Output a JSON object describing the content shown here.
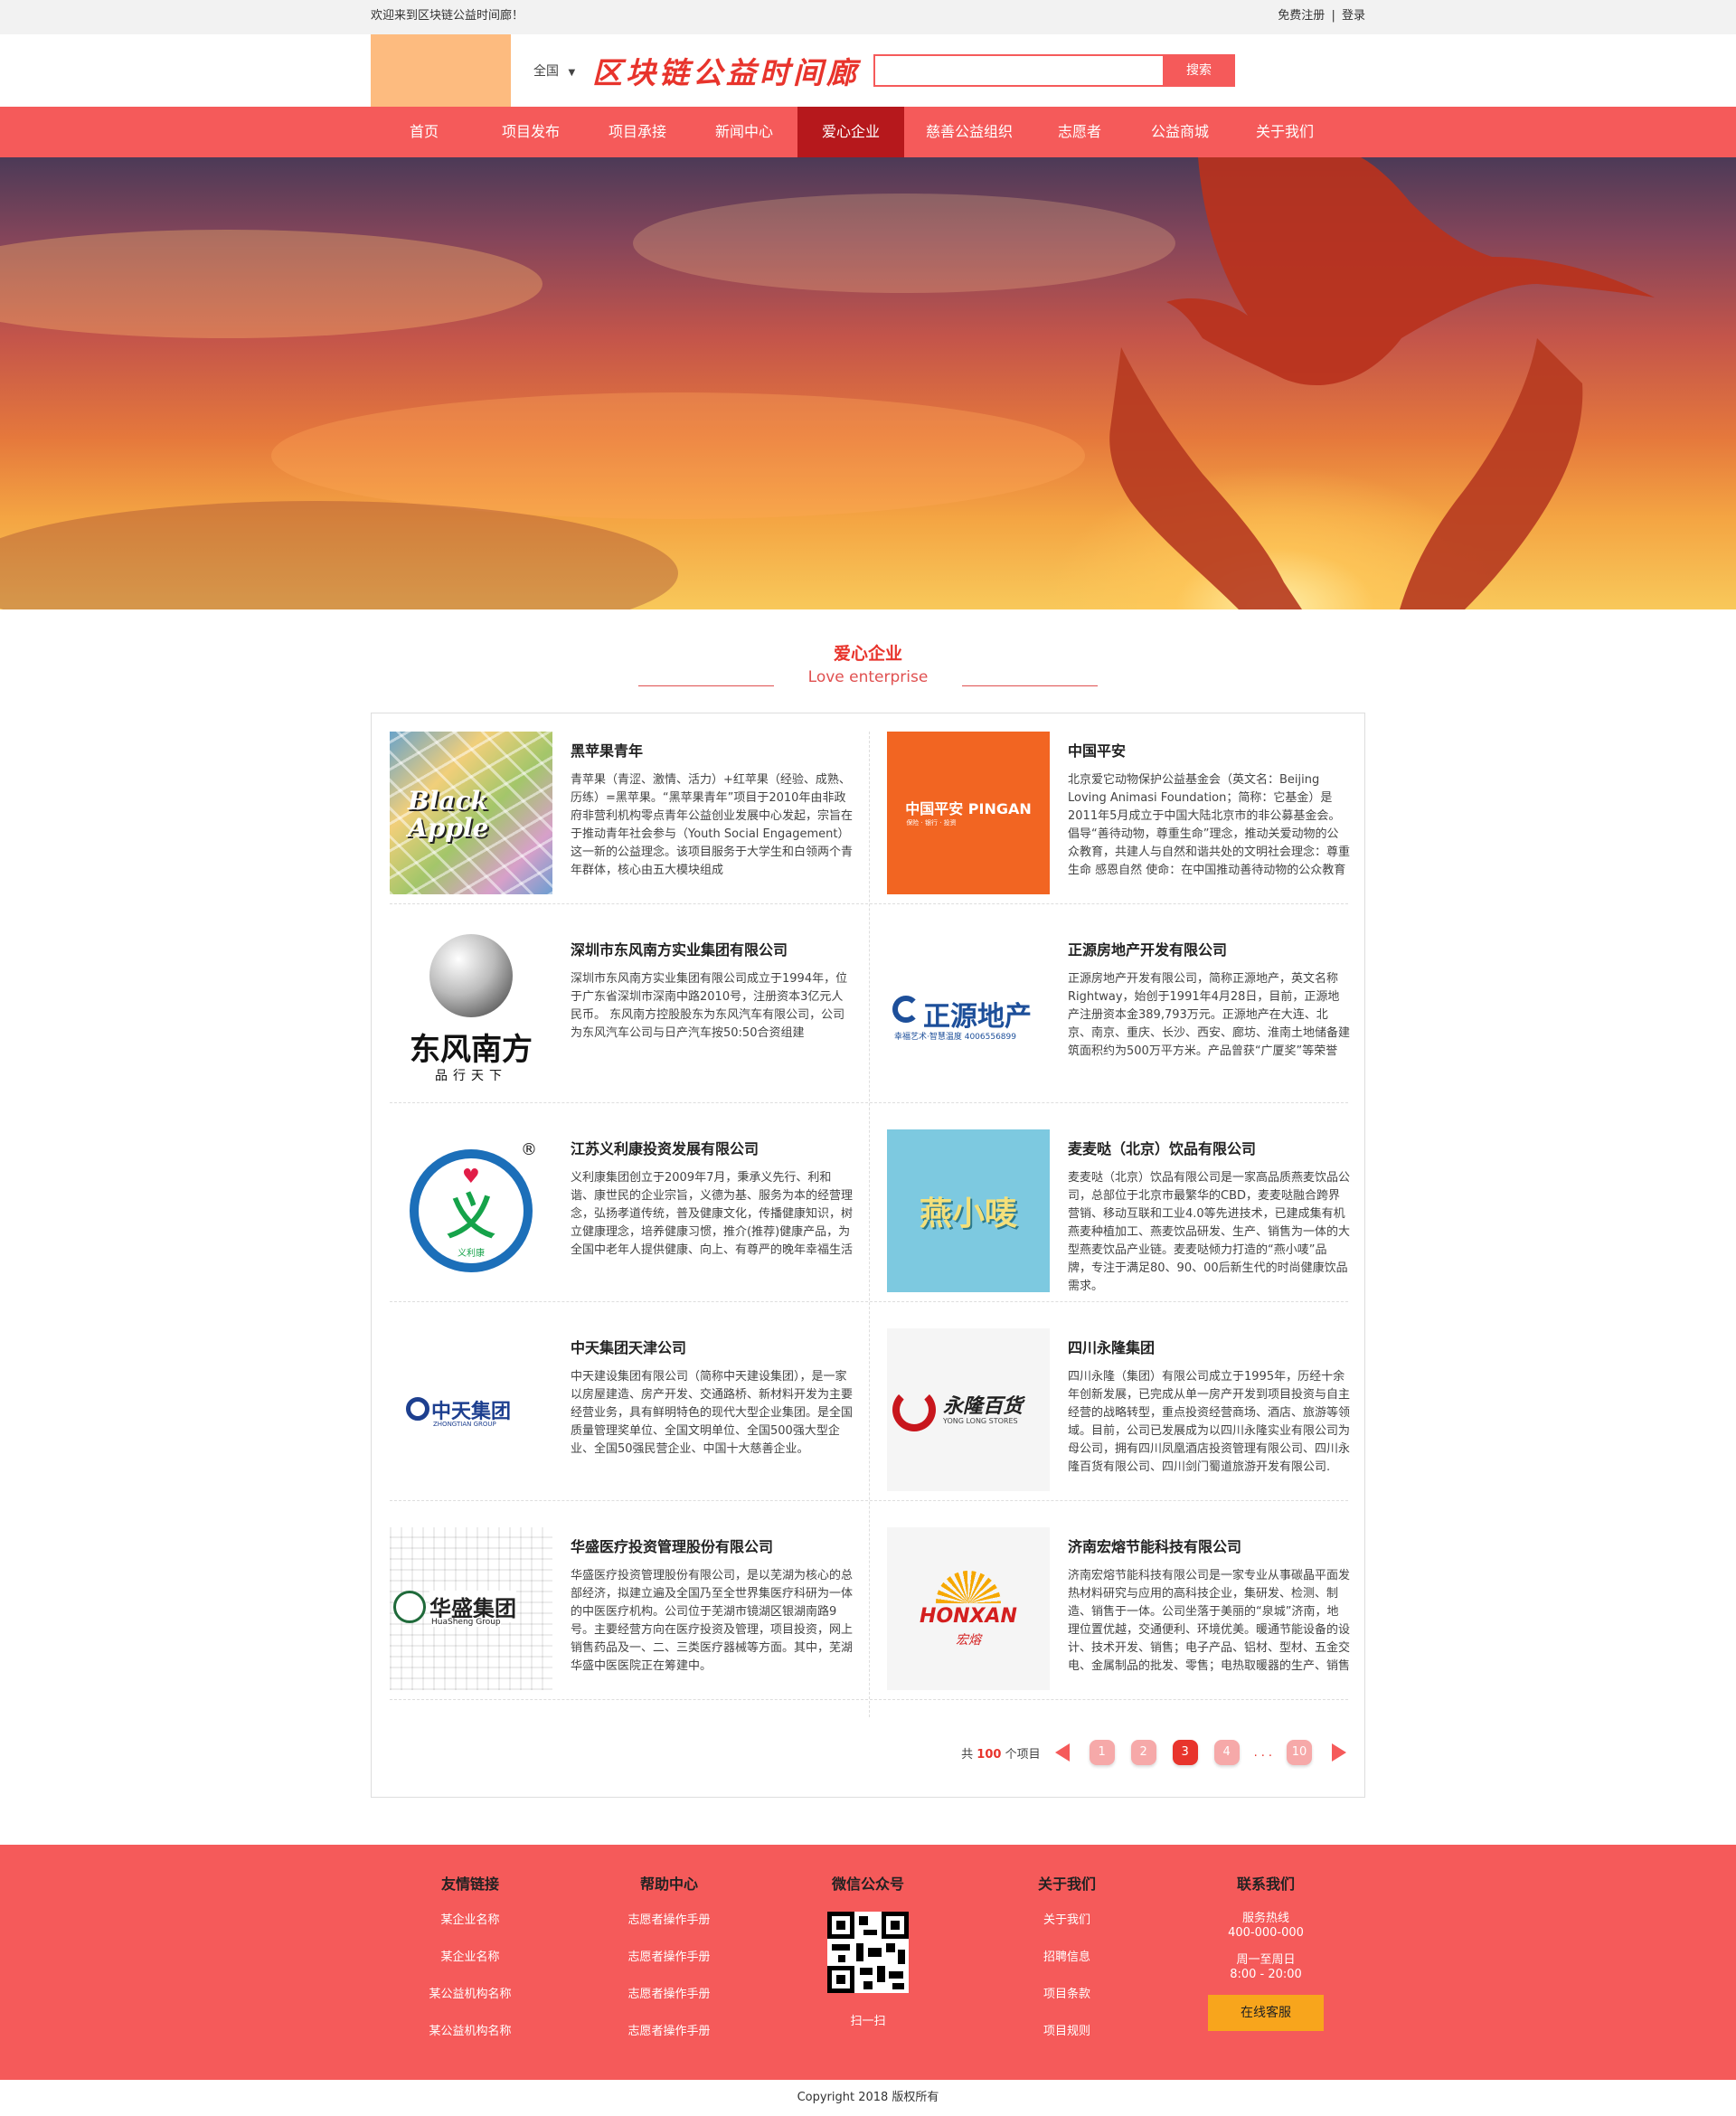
{
  "topbar": {
    "welcome": "欢迎来到区块链公益时间廊！",
    "register": "免费注册",
    "sep": "|",
    "login": "登录"
  },
  "header": {
    "region": "全国",
    "region_icon": "caret-down-icon",
    "site_title": "区块链公益时间廊",
    "search_placeholder": "",
    "search_button": "搜索"
  },
  "nav": {
    "items": [
      "首页",
      "项目发布",
      "项目承接",
      "新闻中心",
      "爱心企业",
      "慈善公益组织",
      "志愿者",
      "公益商城",
      "关于我们"
    ],
    "active_index": 4
  },
  "section": {
    "title_cn": "爱心企业",
    "title_en": "Love enterprise"
  },
  "companies": [
    {
      "name": "黑苹果青年",
      "logo_text": "Black Apple",
      "desc": "青苹果（青涩、激情、活力）+红苹果（经验、成熟、历练）=黑苹果。“黑苹果青年”项目于2010年由非政府非营利机构零点青年公益创业发展中心发起，宗旨在于推动青年社会参与（Youth Social Engagement）这一新的公益理念。该项目服务于大学生和白领两个青年群体，核心由五大模块组成"
    },
    {
      "name": "中国平安",
      "logo_text": "中国平安 PINGAN",
      "logo_sub": "保险 · 银行 · 投资",
      "desc": "北京爱它动物保护公益基金会（英文名：Beijing Loving Animasi Foundation；简称：它基金）是2011年5月成立于中国大陆北京市的非公募基金会。倡导“善待动物，尊重生命”理念，推动关爱动物的公众教育，共建人与自然和谐共处的文明社会理念：尊重生命 感恩自然 使命：在中国推动善待动物的公众教育"
    },
    {
      "name": "深圳市东风南方实业集团有限公司",
      "logo_text": "东风南方",
      "logo_sub": "品行天下",
      "desc": "深圳市东风南方实业集团有限公司成立于1994年，位于广东省深圳市深南中路2010号，注册资本3亿元人民币。 东风南方控股股东为东风汽车有限公司，公司为东风汽车公司与日产汽车按50:50合资组建"
    },
    {
      "name": "正源房地产开发有限公司",
      "logo_text": "正源地产",
      "logo_sub": "幸福艺术·智慧温度 4006556899",
      "desc": "正源房地产开发有限公司，简称正源地产，英文名称Rightway，始创于1991年4月28日，目前，正源地产注册资本金389,793万元。正源地产在大连、北京、南京、重庆、长沙、西安、廊坊、淮南土地储备建筑面积约为500万平方米。产品曾获“广厦奖”等荣誉"
    },
    {
      "name": "江苏义利康投资发展有限公司",
      "logo_text": "义",
      "logo_sub": "义利康",
      "desc": "义利康集团创立于2009年7月，秉承义先行、利和谐、康世民的企业宗旨，义德为基、服务为本的经营理念，弘扬孝道传统，普及健康文化，传播健康知识，树立健康理念，培养健康习惯，推介(推荐)健康产品，为全国中老年人提供健康、向上、有尊严的晚年幸福生活"
    },
    {
      "name": "麦麦哒（北京）饮品有限公司",
      "logo_text": "燕小唛",
      "desc": "麦麦哒（北京）饮品有限公司是一家高品质燕麦饮品公司，总部位于北京市最繁华的CBD，麦麦哒融合跨界营销、移动互联和工业4.0等先进技术，已建成集有机燕麦种植加工、燕麦饮品研发、生产、销售为一体的大型燕麦饮品产业链。麦麦哒倾力打造的“燕小唛”品牌，专注于满足80、90、00后新生代的时尚健康饮品需求。"
    },
    {
      "name": "中天集团天津公司",
      "logo_text": "中天集团",
      "logo_sub": "ZHONGTIAN GROUP",
      "desc": "中天建设集团有限公司（简称中天建设集团），是一家以房屋建造、房产开发、交通路桥、新材料开发为主要经营业务，具有鲜明特色的现代大型企业集团。是全国质量管理奖单位、全国文明单位、全国500强大型企业、全国50强民营企业、中国十大慈善企业。"
    },
    {
      "name": "四川永隆集团",
      "logo_text": "永隆百货",
      "logo_sub": "YONG LONG STORES",
      "desc": "四川永隆（集团）有限公司成立于1995年，历经十余年创新发展，已完成从单一房产开发到项目投资与自主经营的战略转型，重点投资经营商场、酒店、旅游等领域。目前，公司已发展成为以四川永隆实业有限公司为母公司，拥有四川凤凰酒店投资管理有限公司、四川永隆百货有限公司、四川剑门蜀道旅游开发有限公司."
    },
    {
      "name": "华盛医疗投资管理股份有限公司",
      "logo_text": "华盛集团",
      "logo_sub": "HuaSheng Group",
      "desc": "华盛医疗投资管理股份有限公司，是以芜湖为核心的总部经济，拟建立遍及全国乃至全世界集医疗科研为一体的中医医疗机构。公司位于芜湖市镜湖区银湖南路9号。主要经营方向在医疗投资及管理，项目投资，网上销售药品及一、二、三类医疗器械等方面。其中，芜湖华盛中医医院正在筹建中。"
    },
    {
      "name": "济南宏熔节能科技有限公司",
      "logo_text": "HONXAN",
      "logo_sub": "宏熔",
      "desc": "济南宏熔节能科技有限公司是一家专业从事碳晶平面发热材料研究与应用的高科技企业，集研发、检测、制造、销售于一体。公司坐落于美丽的“泉城”济南，地理位置优越，交通便利、环境优美。暖通节能设备的设计、技术开发、销售；电子产品、铝材、型材、五金交电、金属制品的批发、零售；电热取暖器的生产、销售"
    }
  ],
  "pager": {
    "total_prefix": "共",
    "total": "100",
    "total_suffix": "个项目",
    "pages": [
      "1",
      "2",
      "3",
      "4"
    ],
    "current": "3",
    "ellipsis": "...",
    "last": "10",
    "prev_icon": "arrow-left-icon",
    "next_icon": "arrow-right-icon"
  },
  "footer": {
    "links": {
      "title": "友情链接",
      "items": [
        "某企业名称",
        "某企业名称",
        "某公益机构名称",
        "某公益机构名称"
      ]
    },
    "help": {
      "title": "帮助中心",
      "items": [
        "志愿者操作手册",
        "志愿者操作手册",
        "志愿者操作手册",
        "志愿者操作手册"
      ]
    },
    "wechat": {
      "title": "微信公众号",
      "caption": "扫一扫",
      "icon": "qr-code-icon"
    },
    "about": {
      "title": "关于我们",
      "items": [
        "关于我们",
        "招聘信息",
        "项目条款",
        "项目规则"
      ]
    },
    "contact": {
      "title": "联系我们",
      "hotline_label": "服务热线",
      "hotline": "400-000-000",
      "hours_label": "周一至周日",
      "hours": "8:00 - 20:00",
      "service_button": "在线客服"
    }
  },
  "copyright": "Copyright 2018 版权所有",
  "colors": {
    "primary": "#f55a5a",
    "active_nav": "#b6181c",
    "accent_text": "#e8342c",
    "service_button": "#f8a51c",
    "logo_placeholder": "#fdbb7f"
  }
}
